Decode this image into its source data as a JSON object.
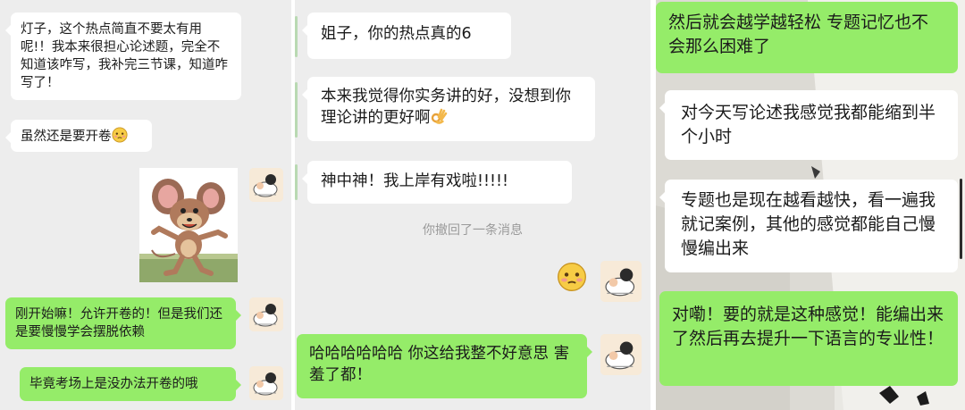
{
  "panel_left": {
    "messages": [
      {
        "side": "left",
        "text": "灯子，这个热点简直不要太有用呢!！我本来很担心论述题，完全不知道该咋写，我补完三节课，知道咋写了！"
      },
      {
        "side": "left",
        "text": "虽然还是要开卷",
        "emoji": "shy-face"
      },
      {
        "side": "right",
        "type": "sticker",
        "emoji": "jerry-mouse-sticker"
      },
      {
        "side": "right",
        "text": "刚开始嘛！允许开卷的！但是我们还是要慢慢学会摆脱依赖"
      },
      {
        "side": "right",
        "text": "毕竟考场上是没办法开卷的哦"
      }
    ]
  },
  "panel_middle": {
    "messages": [
      {
        "side": "left",
        "text": "姐子，你的热点真的6"
      },
      {
        "side": "left",
        "text": "本来我觉得你实务讲的好，没想到你理论讲的更好啊",
        "emoji": "ok-hand"
      },
      {
        "side": "left",
        "text": "神中神！我上岸有戏啦!!!!!"
      },
      {
        "type": "system",
        "text": "你撤回了一条消息"
      },
      {
        "side": "right",
        "type": "emoji-only",
        "emoji": "shy-face"
      },
      {
        "side": "right",
        "text": "哈哈哈哈哈哈 你这给我整不好意思 害羞了都！"
      }
    ]
  },
  "panel_right": {
    "messages": [
      {
        "side": "right",
        "text": "然后就会越学越轻松 专题记忆也不会那么困难了"
      },
      {
        "side": "left",
        "text": "对今天写论述我感觉我都能缩到半个小时"
      },
      {
        "side": "left",
        "text": "专题也是现在越看越快，看一遍我就记案例，其他的感觉都能自己慢慢编出来"
      },
      {
        "side": "right",
        "text": "对嘞！要的就是这种感觉！能编出来了然后再去提升一下语言的专业性！"
      }
    ]
  },
  "colors": {
    "chat_background": "#ededed",
    "sent_bubble": "#95ec69",
    "received_bubble": "#ffffff",
    "system_text": "#9a9a9a"
  }
}
